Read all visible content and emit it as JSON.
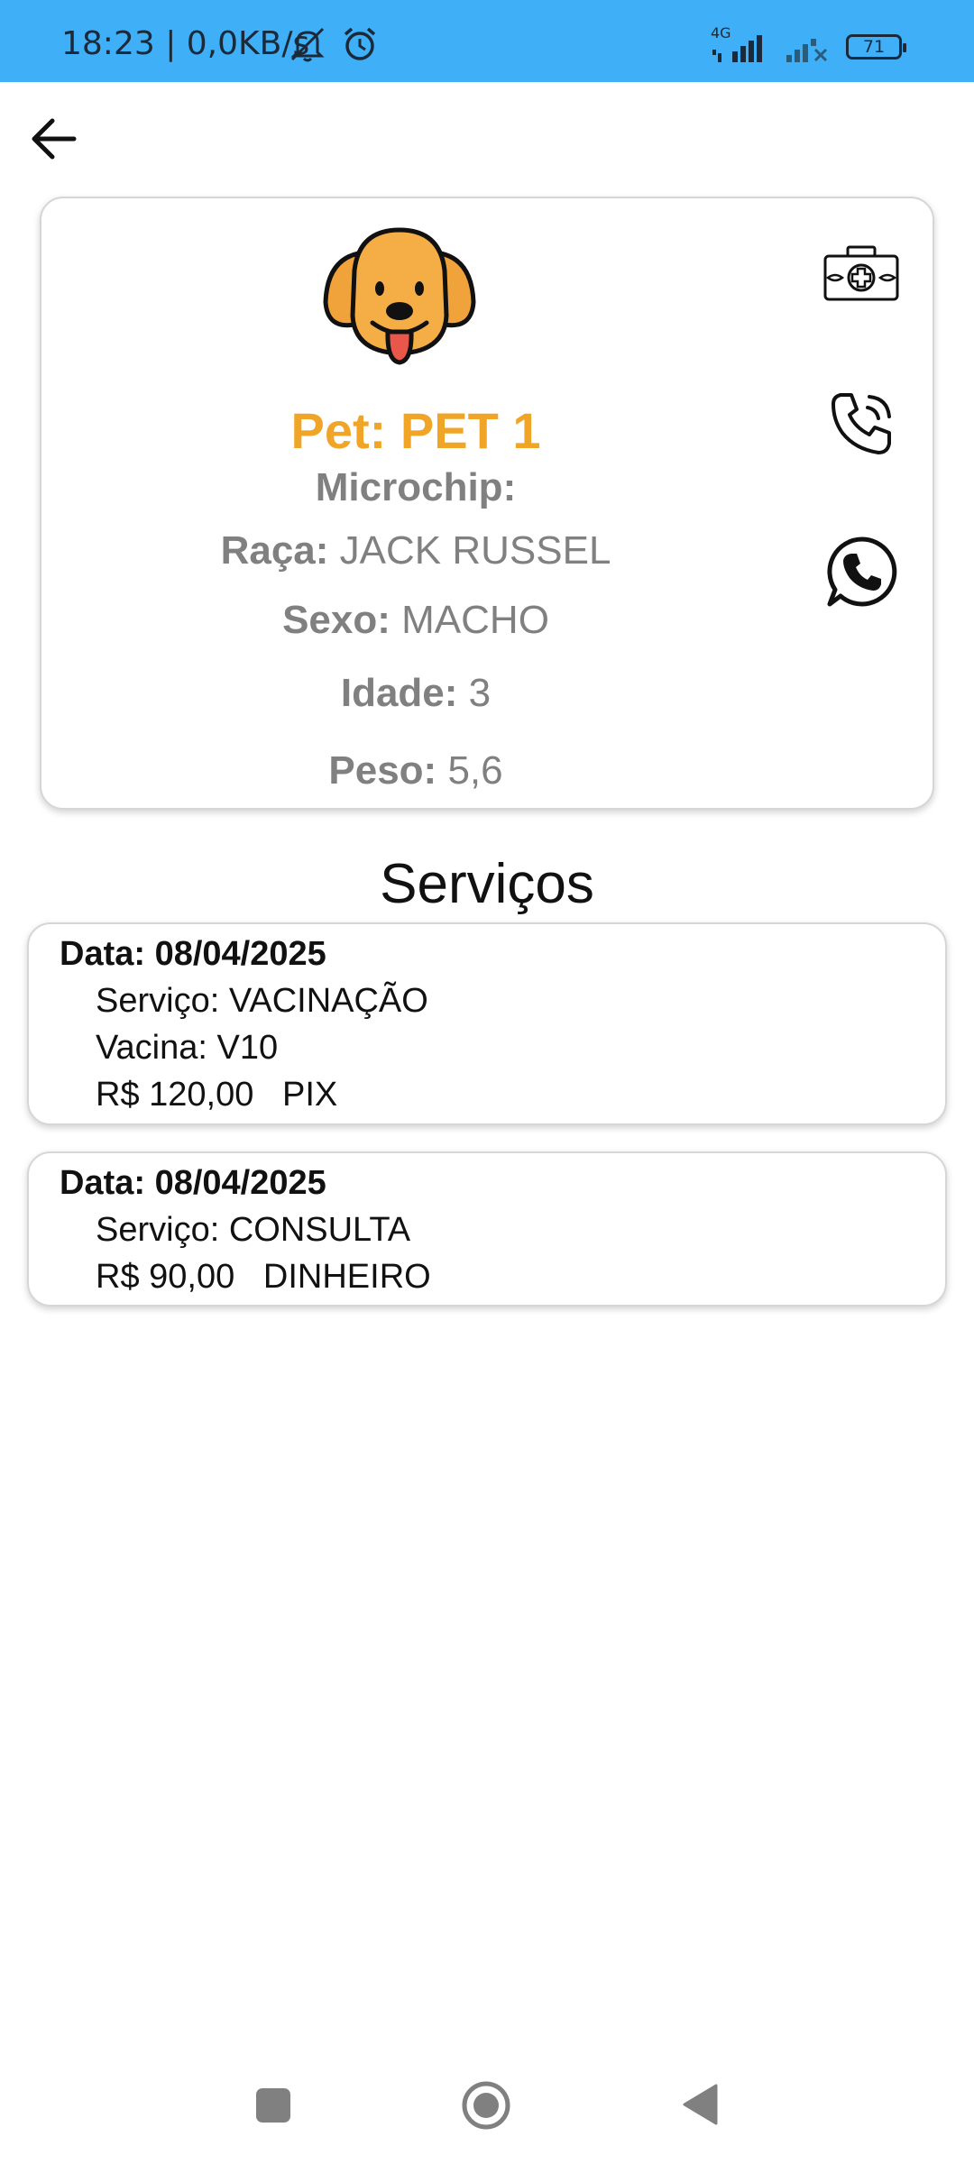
{
  "status_bar": {
    "time_speed": "18:23 | 0,0KB/s",
    "network": "4G",
    "battery": "71"
  },
  "pet": {
    "name_label": "Pet: PET 1",
    "microchip_label": "Microchip:",
    "microchip_value": "",
    "breed_label": "Raça:",
    "breed_value": "JACK RUSSEL",
    "sex_label": "Sexo:",
    "sex_value": "MACHO",
    "age_label": "Idade:",
    "age_value": "3",
    "weight_label": "Peso:",
    "weight_value": "5,6"
  },
  "services": {
    "title": "Serviços",
    "items": [
      {
        "date": "Data: 08/04/2025",
        "service": "Serviço: VACINAÇÃO",
        "vaccine": "Vacina: V10",
        "payment": "R$ 120,00   PIX"
      },
      {
        "date": "Data: 08/04/2025",
        "service": "Serviço: CONSULTA",
        "payment": "R$ 90,00   DINHEIRO"
      }
    ]
  },
  "icons": {
    "back": "arrow-left-icon",
    "medical": "medical-kit-icon",
    "phone": "phone-icon",
    "whatsapp": "whatsapp-icon"
  },
  "colors": {
    "status_bar": "#3fb0f7",
    "pet_name": "#f0a527",
    "info_text": "#808080"
  }
}
